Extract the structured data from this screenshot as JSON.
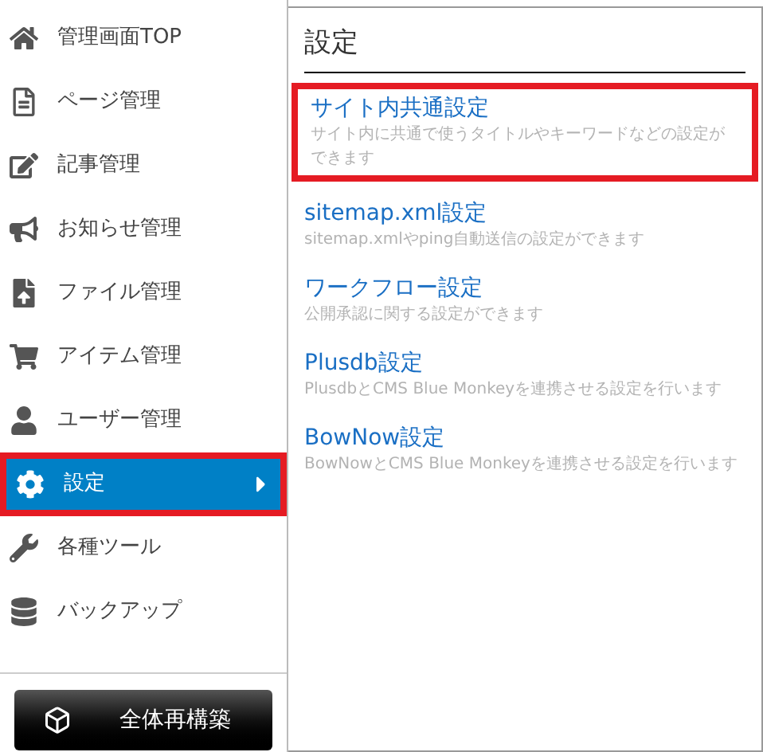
{
  "sidebar": {
    "items": [
      {
        "label": "管理画面TOP",
        "selected": false,
        "highlighted": false
      },
      {
        "label": "ページ管理",
        "selected": false,
        "highlighted": false
      },
      {
        "label": "記事管理",
        "selected": false,
        "highlighted": false
      },
      {
        "label": "お知らせ管理",
        "selected": false,
        "highlighted": false
      },
      {
        "label": "ファイル管理",
        "selected": false,
        "highlighted": false
      },
      {
        "label": "アイテム管理",
        "selected": false,
        "highlighted": false
      },
      {
        "label": "ユーザー管理",
        "selected": false,
        "highlighted": false
      },
      {
        "label": "設定",
        "selected": true,
        "highlighted": true
      },
      {
        "label": "各種ツール",
        "selected": false,
        "highlighted": false
      },
      {
        "label": "バックアップ",
        "selected": false,
        "highlighted": false
      }
    ],
    "rebuild_button": "全体再構築"
  },
  "submenu": {
    "title": "設定",
    "items": [
      {
        "title": "サイト内共通設定",
        "description": "サイト内に共通で使うタイトルやキーワードなどの設定ができます",
        "highlighted": true
      },
      {
        "title": "sitemap.xml設定",
        "description": "sitemap.xmlやping自動送信の設定ができます",
        "highlighted": false
      },
      {
        "title": "ワークフロー設定",
        "description": "公開承認に関する設定ができます",
        "highlighted": false
      },
      {
        "title": "Plusdb設定",
        "description": "PlusdbとCMS Blue Monkeyを連携させる設定を行います",
        "highlighted": false
      },
      {
        "title": "BowNow設定",
        "description": "BowNowとCMS Blue Monkeyを連携させる設定を行います",
        "highlighted": false
      }
    ]
  }
}
